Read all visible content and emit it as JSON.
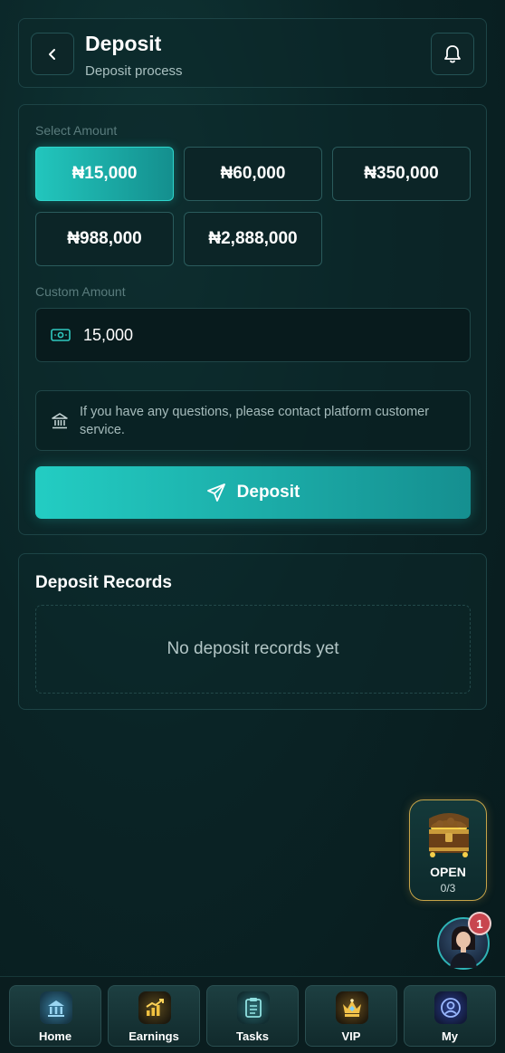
{
  "header": {
    "title": "Deposit",
    "subtitle": "Deposit process"
  },
  "deposit": {
    "select_amount_label": "Select Amount",
    "amounts": [
      "₦15,000",
      "₦60,000",
      "₦350,000",
      "₦988,000",
      "₦2,888,000"
    ],
    "selected_index": 0,
    "custom_amount_label": "Custom Amount",
    "custom_amount_value": "15,000",
    "notice": "If you have any questions, please contact platform customer service.",
    "submit_label": "Deposit"
  },
  "records": {
    "title": "Deposit Records",
    "empty_text": "No deposit records yet"
  },
  "chest": {
    "label": "OPEN",
    "progress": "0/3"
  },
  "support": {
    "badge_count": "1"
  },
  "nav": {
    "items": [
      {
        "label": "Home",
        "icon": "building-icon"
      },
      {
        "label": "Earnings",
        "icon": "chart-icon"
      },
      {
        "label": "Tasks",
        "icon": "clipboard-icon"
      },
      {
        "label": "VIP",
        "icon": "crown-icon"
      },
      {
        "label": "My",
        "icon": "user-icon"
      }
    ]
  },
  "colors": {
    "accent": "#22c6bd",
    "background": "#0a2426",
    "badge": "#c8464f",
    "gold": "#c7a448"
  }
}
